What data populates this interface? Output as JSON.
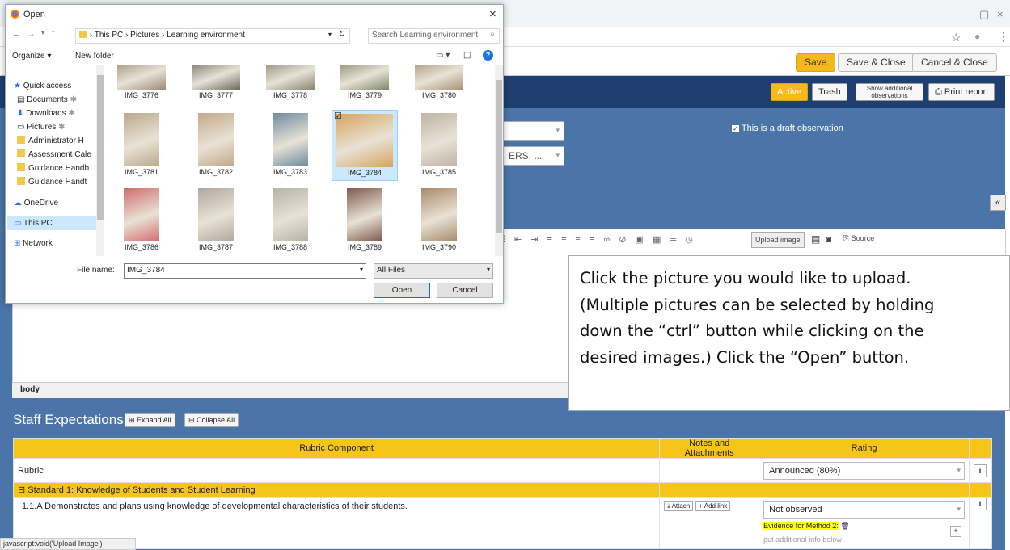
{
  "browser": {
    "window_controls": {
      "minimize": "–",
      "restore": "▢",
      "close": "×"
    },
    "addr_icons": {
      "star": "☆",
      "account": "●",
      "menu": "⋮"
    }
  },
  "app": {
    "toolbar": {
      "save": "Save",
      "save_close": "Save & Close",
      "cancel_close": "Cancel & Close"
    },
    "nav": {
      "active": "Active",
      "trash": "Trash",
      "show_additional": "Show additional observations",
      "print": "Print report"
    },
    "draft_label": "This is a draft observation",
    "select_partial": "ERS, ...",
    "collapse_symbol": "«",
    "editor": {
      "upload_image": "Upload image",
      "source": "Source",
      "footer": "body"
    },
    "callout": {
      "lines": [
        "Click the picture you would like to upload.",
        "(Multiple pictures can be selected by holding",
        "down the “ctrl” button while clicking on the",
        "desired images.) Click the “Open” button."
      ]
    },
    "staff": {
      "title": "Staff Expectations",
      "expand_all": "⊞ Expand All",
      "collapse_all": "⊟ Collapse All",
      "headers": {
        "component": "Rubric Component",
        "notes": "Notes and Attachments",
        "rating": "Rating"
      },
      "rubric_label": "Rubric",
      "rubric_rating": "Announced (80%)",
      "standard": "⊟ Standard 1: Knowledge of Students and Student Learning",
      "item": "1.1.A Demonstrates and plans using knowledge of developmental characteristics of their students.",
      "attach": "Attach",
      "add_link": "+ Add link",
      "item_rating": "Not observed",
      "evidence": "Evidence for Method 2:",
      "additional_info": "put additional info below",
      "info_btn": "i",
      "plus_btn": "+"
    },
    "status_url": "javascript:void('Upload Image')"
  },
  "dialog": {
    "title": "Open",
    "close": "×",
    "breadcrumb": "›  This PC  ›  Pictures  ›  Learning environment",
    "search_placeholder": "Search Learning environment",
    "organize": "Organize ▾",
    "new_folder": "New folder",
    "help": "?",
    "nav_items": [
      {
        "label": "Quick access"
      },
      {
        "label": "Documents"
      },
      {
        "label": "Downloads"
      },
      {
        "label": "Pictures"
      },
      {
        "label": "Administrator H"
      },
      {
        "label": "Assessment Cale"
      },
      {
        "label": "Guidance Handb"
      },
      {
        "label": "Guidance Handt"
      },
      {
        "label": "OneDrive"
      },
      {
        "label": "This PC"
      },
      {
        "label": "Network"
      }
    ],
    "files": [
      {
        "name": "IMG_3776",
        "color": "#9a8c78"
      },
      {
        "name": "IMG_3777",
        "color": "#6f6a5e"
      },
      {
        "name": "IMG_3778",
        "color": "#8a8474"
      },
      {
        "name": "IMG_3779",
        "color": "#7d8a6a"
      },
      {
        "name": "IMG_3780",
        "color": "#a89276"
      },
      {
        "name": "IMG_3781",
        "color": "#b9a98c"
      },
      {
        "name": "IMG_3782",
        "color": "#c4a888"
      },
      {
        "name": "IMG_3783",
        "color": "#6e8aa0"
      },
      {
        "name": "IMG_3784",
        "color": "#d7a35c"
      },
      {
        "name": "IMG_3785",
        "color": "#bfb3a4"
      },
      {
        "name": "IMG_3786",
        "color": "#d26d6d"
      },
      {
        "name": "IMG_3787",
        "color": "#b0a79e"
      },
      {
        "name": "IMG_3788",
        "color": "#b7b2a6"
      },
      {
        "name": "IMG_3789",
        "color": "#7f5a4c"
      },
      {
        "name": "IMG_3790",
        "color": "#a98a6b"
      }
    ],
    "selected_file": "IMG_3784",
    "file_name_label": "File name:",
    "file_name_value": "IMG_3784",
    "file_type": "All Files",
    "open": "Open",
    "cancel": "Cancel"
  }
}
